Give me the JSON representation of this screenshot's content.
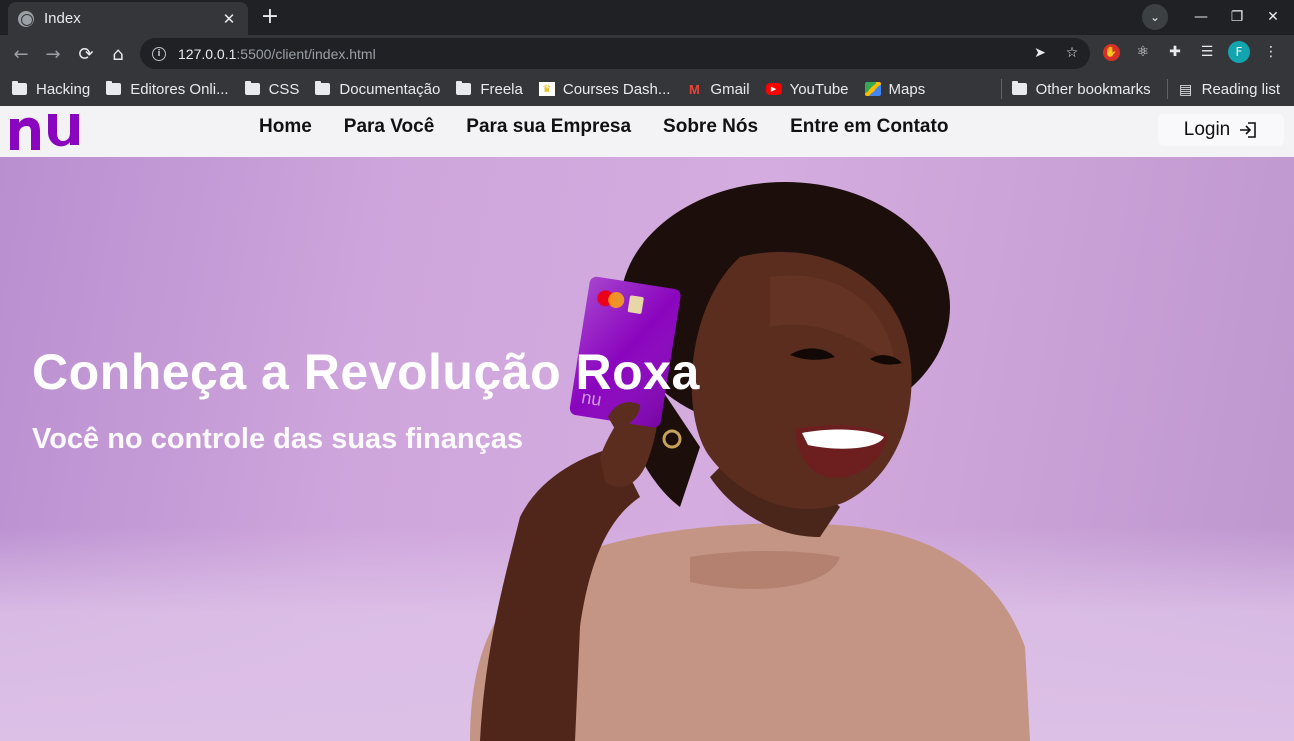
{
  "browser": {
    "tab_title": "Index",
    "url_host": "127.0.0.1",
    "url_path": ":5500/client/index.html",
    "profile_initial": "F",
    "bookmarks": [
      {
        "label": "Hacking",
        "icon": "folder-icon"
      },
      {
        "label": "Editores Onli...",
        "icon": "folder-icon"
      },
      {
        "label": "CSS",
        "icon": "folder-icon"
      },
      {
        "label": "Documentação",
        "icon": "folder-icon"
      },
      {
        "label": "Freela",
        "icon": "folder-icon"
      },
      {
        "label": "Courses Dash...",
        "icon": "courses-icon"
      },
      {
        "label": "Gmail",
        "icon": "gmail-icon"
      },
      {
        "label": "YouTube",
        "icon": "youtube-icon"
      },
      {
        "label": "Maps",
        "icon": "maps-icon"
      }
    ],
    "other_bookmarks": "Other bookmarks",
    "reading_list": "Reading list"
  },
  "site": {
    "nav": [
      "Home",
      "Para Você",
      "Para sua Empresa",
      "Sobre Nós",
      "Entre em Contato"
    ],
    "login_label": "Login",
    "hero_title": "Conheça a Revolução Roxa",
    "hero_subtitle": "Você no controle das suas finanças",
    "card_logo": "nu",
    "accent_color": "#8a05be"
  }
}
